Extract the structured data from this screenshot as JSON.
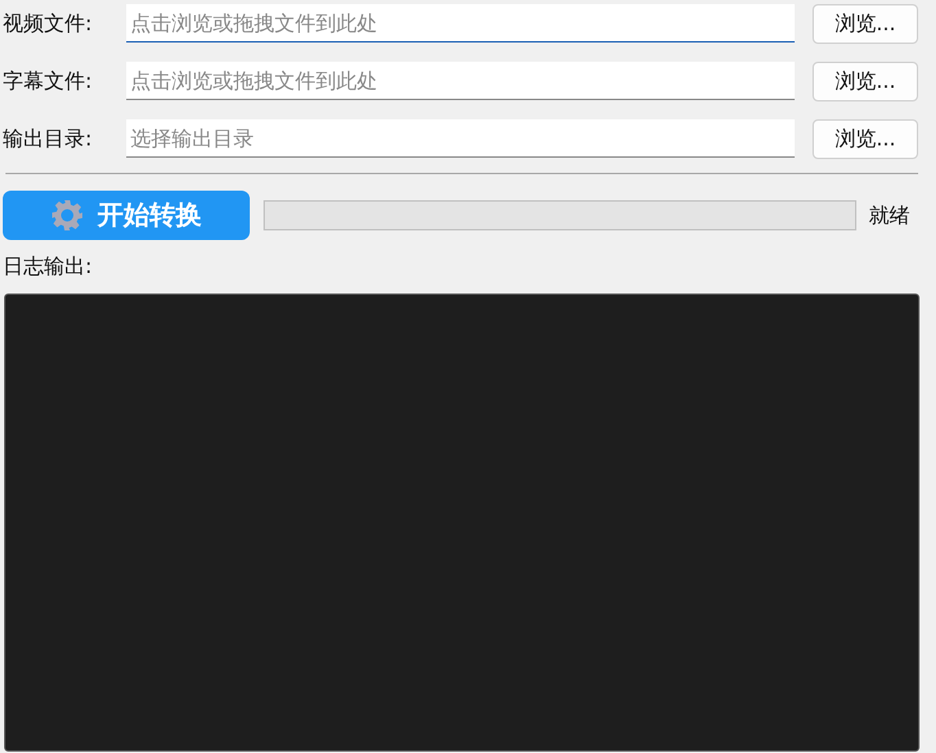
{
  "fields": [
    {
      "label": "视频文件:",
      "placeholder": "点击浏览或拖拽文件到此处",
      "focused": true,
      "button": "浏览..."
    },
    {
      "label": "字幕文件:",
      "placeholder": "点击浏览或拖拽文件到此处",
      "focused": false,
      "button": "浏览..."
    },
    {
      "label": "输出目录:",
      "placeholder": "选择输出目录",
      "focused": false,
      "button": "浏览..."
    }
  ],
  "start_button": "开始转换",
  "progress": {
    "level": 0,
    "status": "就绪"
  },
  "log": {
    "label": "日志输出:"
  }
}
